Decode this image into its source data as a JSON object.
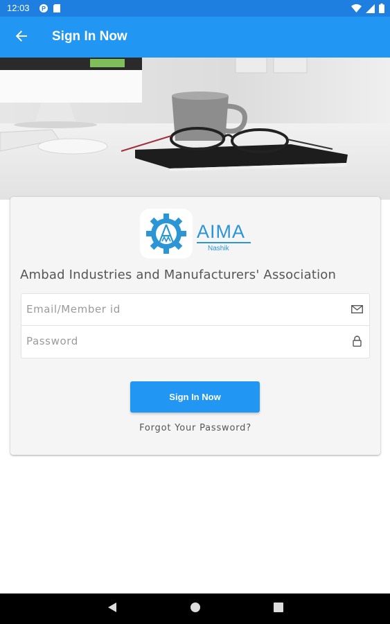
{
  "status_bar": {
    "time": "12:03",
    "left_icons": [
      "app-notification-icon",
      "sd-card-icon"
    ],
    "right_icons": [
      "wifi-icon",
      "signal-icon",
      "battery-icon"
    ]
  },
  "app_bar": {
    "back_icon": "arrow-left-icon",
    "title": "Sign In Now"
  },
  "hero": {
    "description_icon": "desk-photo"
  },
  "logo": {
    "text": "AIMA",
    "sub": "Nashik"
  },
  "org_name": "Ambad Industries and Manufacturers' Association",
  "form": {
    "email": {
      "placeholder": "Email/Member id",
      "value": "",
      "icon": "envelope-icon"
    },
    "password": {
      "placeholder": "Password",
      "value": "",
      "icon": "lock-icon"
    }
  },
  "signin_button": "Sign In Now",
  "forgot_password": "Forgot Your Password?",
  "nav_bar": {
    "buttons": [
      "back-triangle-icon",
      "home-circle-icon",
      "recents-square-icon"
    ]
  },
  "colors": {
    "status_bar": "#1e7fe0",
    "app_bar": "#2196f3",
    "accent": "#2196f3",
    "logo": "#2b95d6"
  }
}
